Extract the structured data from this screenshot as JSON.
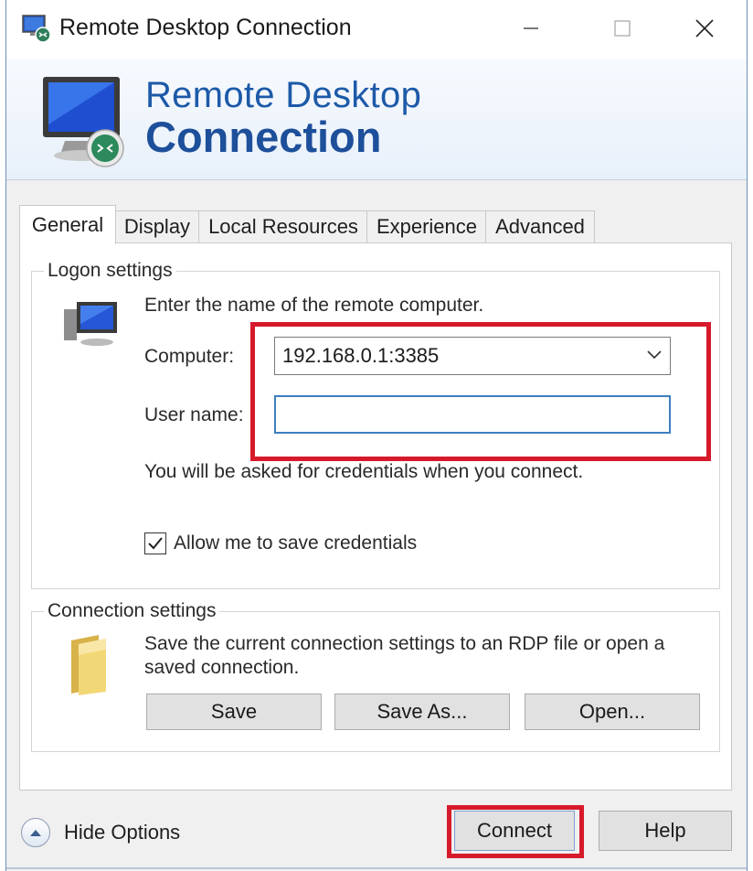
{
  "window": {
    "title": "Remote Desktop Connection",
    "controls": {
      "minimize": "minimize",
      "maximize": "maximize",
      "close": "close"
    }
  },
  "banner": {
    "line1": "Remote Desktop",
    "line2": "Connection"
  },
  "tabs": [
    {
      "label": "General",
      "active": true
    },
    {
      "label": "Display",
      "active": false
    },
    {
      "label": "Local Resources",
      "active": false
    },
    {
      "label": "Experience",
      "active": false
    },
    {
      "label": "Advanced",
      "active": false
    }
  ],
  "logon": {
    "group_label": "Logon settings",
    "instruction": "Enter the name of the remote computer.",
    "computer_label": "Computer:",
    "computer_value": "192.168.0.1:3385",
    "username_label": "User name:",
    "username_value": "",
    "credentials_note": "You will be asked for credentials when you connect.",
    "save_credentials_label": "Allow me to save credentials",
    "save_credentials_checked": true
  },
  "connection": {
    "group_label": "Connection settings",
    "description_line1": "Save the current connection settings to an RDP file or open a",
    "description_line2": "saved connection.",
    "save_label": "Save",
    "save_as_label": "Save As...",
    "open_label": "Open..."
  },
  "footer": {
    "hide_options_label": "Hide Options",
    "connect_label": "Connect",
    "help_label": "Help"
  },
  "colors": {
    "banner_text": "#1d5aa8",
    "highlight": "#d71a2b",
    "focus_border": "#3d7fbf"
  }
}
